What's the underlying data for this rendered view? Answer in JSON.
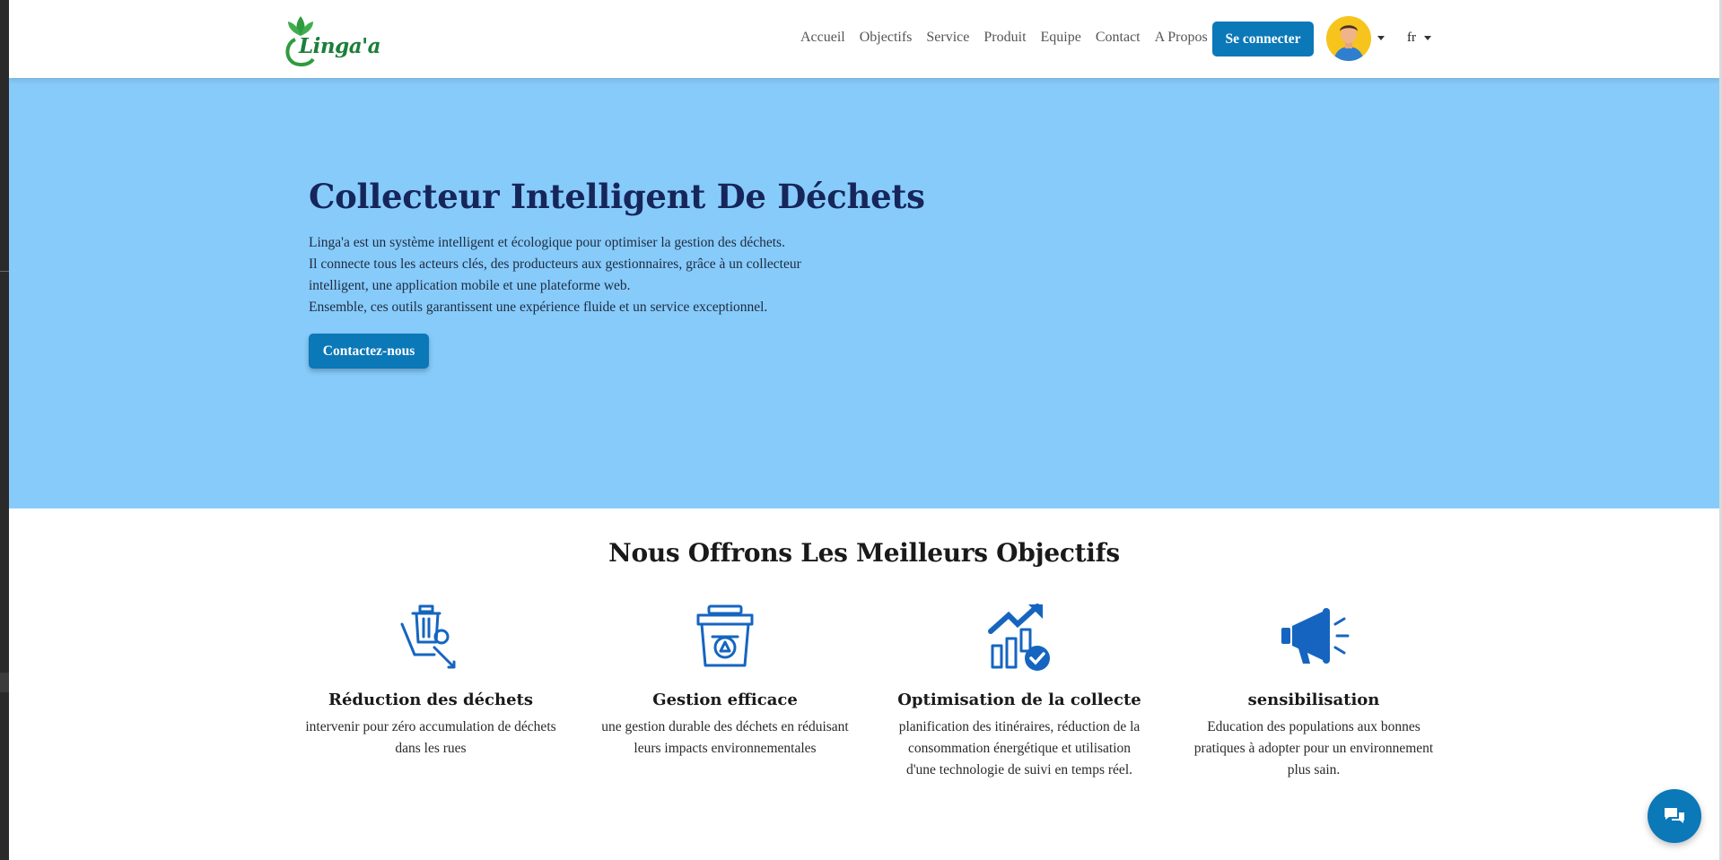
{
  "brand": {
    "logo_text": "Linga'a"
  },
  "nav": {
    "links": [
      "Accueil",
      "Objectifs",
      "Service",
      "Produit",
      "Equipe",
      "Contact",
      "A Propos"
    ],
    "login_label": "Se connecter",
    "language": "fr"
  },
  "hero": {
    "title": "Collecteur Intelligent De Déchets",
    "lines": [
      "Linga'a est un système intelligent et écologique pour optimiser la gestion des déchets.",
      "Il connecte tous les acteurs clés, des producteurs aux gestionnaires, grâce à un collecteur intelligent, une application mobile et une plateforme web.",
      "Ensemble, ces outils garantissent une expérience fluide et un service exceptionnel."
    ],
    "cta_label": "Contactez-nous"
  },
  "objectives": {
    "title": "Nous Offrons Les Meilleurs Objectifs",
    "items": [
      {
        "title": "Réduction des déchets",
        "text": "intervenir pour zéro accumulation de déchets dans les rues",
        "icon": "waste-reduction-icon"
      },
      {
        "title": "Gestion efficace",
        "text": "une gestion durable des déchets en réduisant leurs impacts environnementales",
        "icon": "recycle-bin-gear-icon"
      },
      {
        "title": "Optimisation de la collecte",
        "text": "planification des itinéraires, réduction de la consommation énergétique et utilisation d'une technologie de suivi en temps réel.",
        "icon": "growth-chart-check-icon"
      },
      {
        "title": "sensibilisation",
        "text": "Education des populations aux bonnes pratiques à adopter pour un environnement plus sain.",
        "icon": "megaphone-icon"
      }
    ]
  },
  "colors": {
    "primary": "#0b78b8",
    "hero_bg": "#87cbfb",
    "icon": "#1565c0",
    "title": "#16265a",
    "logo_green": "#1b7f3a"
  }
}
